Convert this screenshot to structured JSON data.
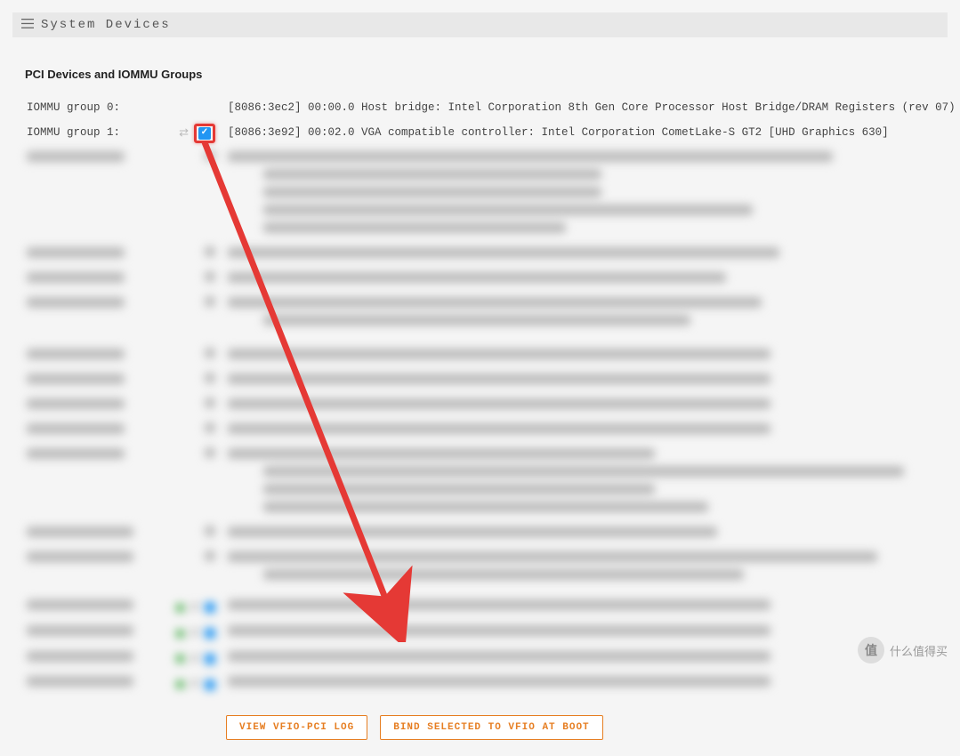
{
  "header": {
    "title": "System Devices"
  },
  "section_title": "PCI Devices and IOMMU Groups",
  "rows": {
    "r0": {
      "group": "IOMMU group 0:",
      "desc": "[8086:3ec2] 00:00.0 Host bridge: Intel Corporation 8th Gen Core Processor Host Bridge/DRAM Registers (rev 07)"
    },
    "r1": {
      "group": "IOMMU group 1:",
      "desc": "[8086:3e92] 00:02.0 VGA compatible controller: Intel Corporation CometLake-S GT2 [UHD Graphics 630]"
    }
  },
  "buttons": {
    "view_log": "VIEW VFIO-PCI LOG",
    "bind": "BIND SELECTED TO VFIO AT BOOT"
  },
  "watermark": {
    "badge": "值",
    "text": "什么值得买"
  }
}
